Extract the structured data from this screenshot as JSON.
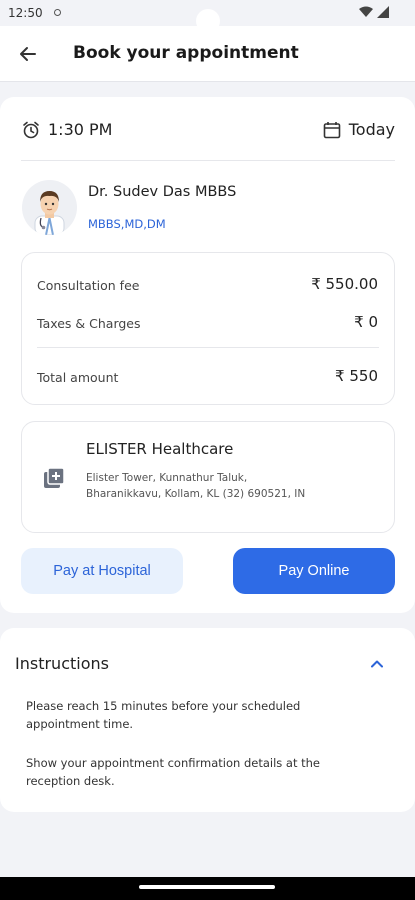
{
  "status": {
    "time": "12:50"
  },
  "header": {
    "title": "Book your appointment",
    "back_icon": "arrow-left-icon"
  },
  "appointment": {
    "time": "1:30 PM",
    "date": "Today"
  },
  "doctor": {
    "name": "Dr. Sudev Das MBBS",
    "qualifications": "MBBS,MD,DM"
  },
  "fees": {
    "consultation_label": "Consultation fee",
    "consultation_value": "₹ 550.00",
    "taxes_label": "Taxes & Charges",
    "taxes_value": "₹ 0",
    "total_label": "Total amount",
    "total_value": "₹ 550"
  },
  "hospital": {
    "name": "ELISTER Healthcare",
    "address": "Elister Tower, Kunnathur Taluk, Bharanikkavu, Kollam, KL (32) 690521, IN"
  },
  "buttons": {
    "pay_hospital": "Pay at Hospital",
    "pay_online": "Pay Online"
  },
  "instructions": {
    "title": "Instructions",
    "items": [
      "Please reach 15 minutes before your scheduled appointment time.",
      "Show your appointment confirmation details at the reception desk."
    ]
  },
  "colors": {
    "accent": "#2e6be6",
    "accent_light": "#e8f1fd",
    "link": "#2c64d8"
  }
}
